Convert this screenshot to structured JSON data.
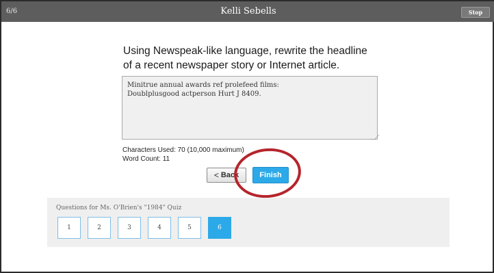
{
  "header": {
    "progress": "6/6",
    "title": "Kelli Sebells",
    "stop_label": "Stop"
  },
  "question": {
    "prompt": "Using Newspeak-like language, rewrite the headline of a recent newspaper story or Internet article."
  },
  "answer": {
    "value": "Minitrue annual awards ref prolefeed films:\nDoublplusgood actperson Hurt J 8409."
  },
  "stats": {
    "characters": "Characters Used: 70 (10,000 maximum)",
    "words": "Word Count: 11"
  },
  "nav": {
    "back_label": "Back",
    "back_icon": "<",
    "finish_label": "Finish"
  },
  "questions_panel": {
    "label": "Questions for Ms. O'Brien's \"1984\" Quiz",
    "numbers": [
      "1",
      "2",
      "3",
      "4",
      "5",
      "6"
    ],
    "active_index": 5
  },
  "colors": {
    "accent": "#2ca9e8",
    "header_bg": "#5d5d5d",
    "annotation_circle": "#b5252c"
  }
}
